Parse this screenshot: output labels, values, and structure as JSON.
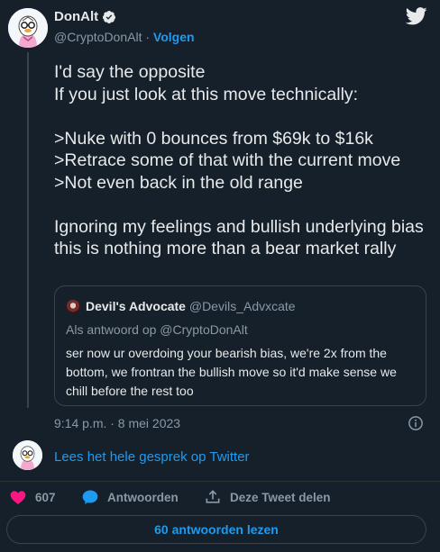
{
  "author": {
    "display_name": "DonAlt",
    "handle": "@CryptoDonAlt",
    "separator": " · ",
    "follow_label": "Volgen"
  },
  "tweet": {
    "text": "I'd say the opposite\nIf you just look at this move technically:\n\n>Nuke with 0 bounces from $69k to $16k\n>Retrace some of that with the current move\n>Not even back in the old range\n\nIgnoring my feelings and bullish underlying bias this is nothing more than a bear market rally",
    "timestamp": "9:14 p.m. · 8 mei 2023"
  },
  "quoted": {
    "display_name": "Devil's Advocate",
    "handle": "@Devils_Advxcate",
    "reply_to": "Als antwoord op @CryptoDonAlt",
    "text": "ser now ur overdoing your bearish bias, we're 2x from the bottom, we frontran the bullish move so it'd make sense we chill before the rest too"
  },
  "conversation_link": "Lees het hele gesprek op Twitter",
  "actions": {
    "like_count": "607",
    "reply_label": "Antwoorden",
    "share_label": "Deze Tweet delen"
  },
  "read_replies_label": "60 antwoorden lezen",
  "colors": {
    "background": "#15202b",
    "accent": "#1d9bf0",
    "like": "#f91880",
    "muted": "#8b98a5",
    "border": "#38444d"
  },
  "icons": [
    "avatar",
    "verified-badge-icon",
    "twitter-bird-icon",
    "info-icon",
    "heart-icon",
    "reply-bubble-icon",
    "share-icon"
  ]
}
